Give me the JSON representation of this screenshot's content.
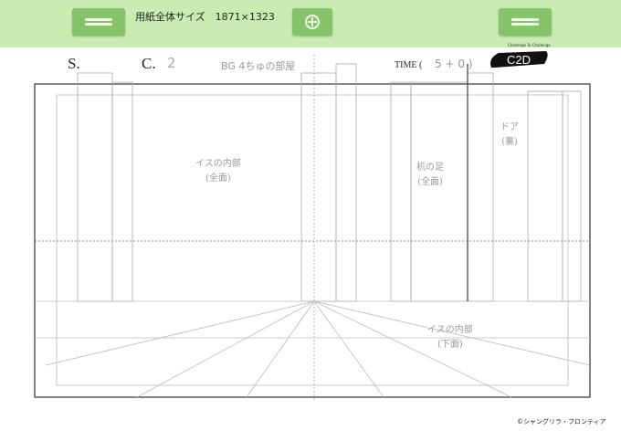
{
  "toolbar": {
    "title": "用紙全体サイズ　1871×1323",
    "left_button_icon": "collapse-bars-icon",
    "center_button_icon": "crosshair-icon",
    "right_button_icon": "collapse-bars-icon"
  },
  "header": {
    "scene_label": "S.",
    "cut_label": "C.",
    "cut_value": "2",
    "note": "BG 4ちゅの部屋",
    "time_label": "TIME (",
    "time_value": "5 + 0 )",
    "logo_text": "C2D",
    "logo_caption": "Challenge To Challenge"
  },
  "sketch": {
    "note_left_1": "イスの内部",
    "note_left_2": "(全面)",
    "note_mid_1": "机の足",
    "note_mid_2": "(全面)",
    "note_right_1": "ドア",
    "note_right_2": "(裏)",
    "note_floor_1": "イスの内部",
    "note_floor_2": "(下面)"
  },
  "footer": {
    "copyright": "©シャングリラ・フロンティア"
  },
  "colors": {
    "toolbar_bg": "#c9ecb3",
    "button_bg": "#86c46a",
    "pencil": "#9a9a9a"
  }
}
